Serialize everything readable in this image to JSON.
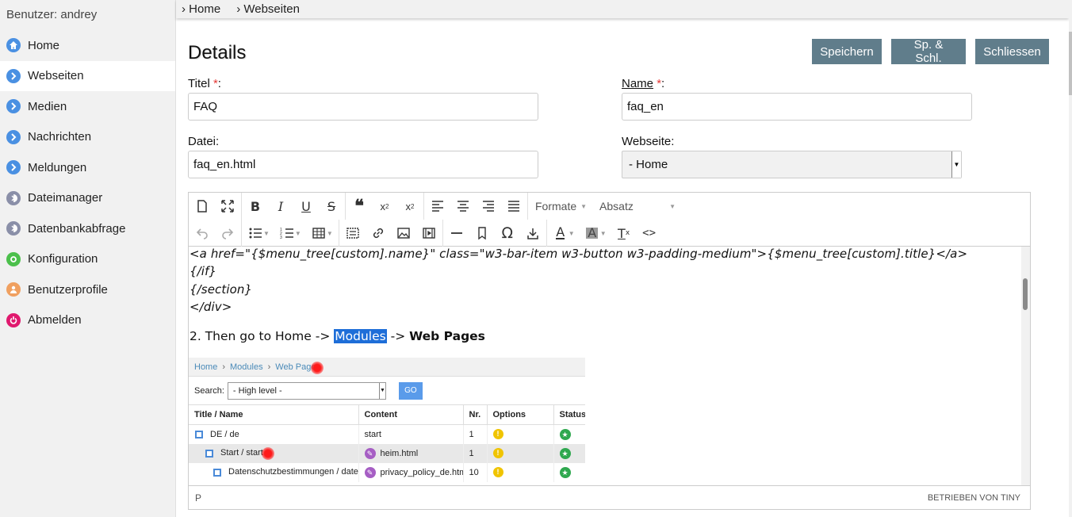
{
  "sidebar": {
    "user_label": "Benutzer: andrey",
    "items": [
      {
        "label": "Home",
        "icon": "home-icon",
        "color": "#4a90e2"
      },
      {
        "label": "Webseiten",
        "icon": "chevron-right-icon",
        "color": "#4a90e2"
      },
      {
        "label": "Medien",
        "icon": "chevron-right-icon",
        "color": "#4a90e2"
      },
      {
        "label": "Nachrichten",
        "icon": "chevron-right-icon",
        "color": "#4a90e2"
      },
      {
        "label": "Meldungen",
        "icon": "chevron-right-icon",
        "color": "#4a90e2"
      },
      {
        "label": "Dateimanager",
        "icon": "half-circle-icon",
        "color": "#8a8fa8"
      },
      {
        "label": "Datenbankabfrage",
        "icon": "half-circle-icon",
        "color": "#8a8fa8"
      },
      {
        "label": "Konfiguration",
        "icon": "gear-icon",
        "color": "#4cc04c"
      },
      {
        "label": "Benutzerprofile",
        "icon": "user-icon",
        "color": "#f0a060"
      },
      {
        "label": "Abmelden",
        "icon": "power-icon",
        "color": "#e0196e"
      }
    ],
    "active_index": 1
  },
  "breadcrumb": [
    "› Home",
    "› Webseiten"
  ],
  "page": {
    "title": "Details",
    "buttons": {
      "save": "Speichern",
      "save_close": "Sp. & Schl.",
      "close": "Schliessen"
    },
    "button_color": "#607d8b"
  },
  "form": {
    "title_label": "Titel",
    "title_value": "FAQ",
    "name_label": "Name",
    "name_value": "faq_en",
    "required_mark": "*",
    "colon": ":",
    "file_label": "Datei:",
    "file_value": "faq_en.html",
    "website_label": "Webseite:",
    "website_value": "-   Home"
  },
  "editor": {
    "formats_label": "Formate",
    "block_label": "Absatz",
    "code_lines": [
      "<a href=\"{$menu_tree[custom].name}\" class=\"w3-bar-item w3-button w3-padding-medium\">{$menu_tree[custom].title}</a>",
      "{/if}",
      "{/section}",
      "</div>"
    ],
    "step_prefix": "2. Then go to Home -> ",
    "step_highlight": "Modules",
    "step_middle": " -> ",
    "step_bold": "Web Pages",
    "status_left": "P",
    "status_right": "BETRIEBEN VON TINY",
    "highlight_color": "#1e6ed8"
  },
  "embedded": {
    "crumbs": [
      "Home",
      "›",
      "Modules",
      "›",
      "Web Pages"
    ],
    "search_label": "Search:",
    "search_value": "- High level -",
    "go_label": "GO",
    "columns": [
      "Title / Name",
      "Content",
      "Nr.",
      "Options",
      "Status"
    ],
    "rows": [
      {
        "title": "DE / de",
        "content": "start",
        "nr": "1"
      },
      {
        "title": "Start / start",
        "content": "heim.html",
        "nr": "1"
      },
      {
        "title": "Datenschutzbestimmungen / datenschutzbestimmungen",
        "content": "privacy_policy_de.html",
        "nr": "10"
      }
    ]
  }
}
